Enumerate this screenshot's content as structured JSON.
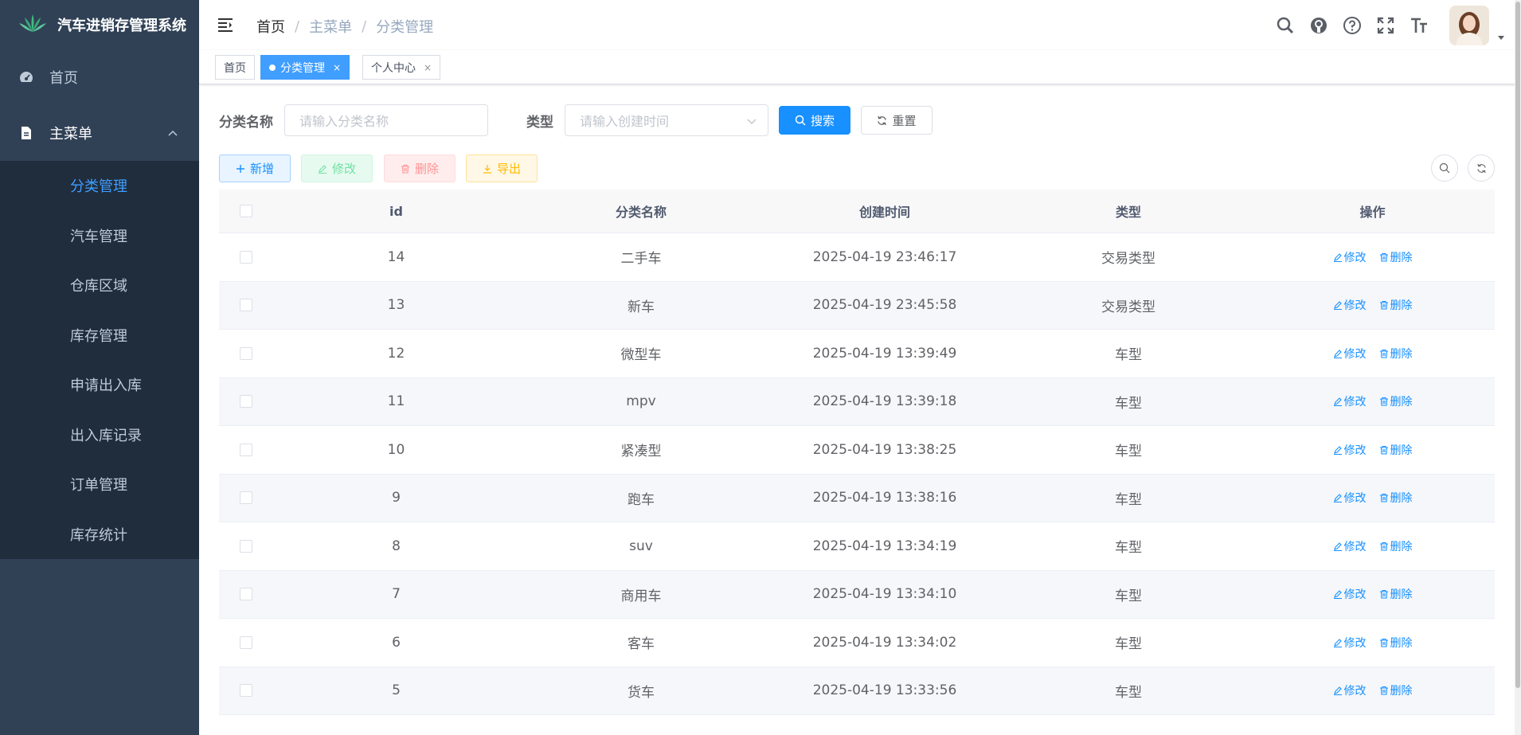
{
  "app": {
    "title": "汽车进销存管理系统"
  },
  "sidebar": {
    "home_label": "首页",
    "main_menu_label": "主菜单",
    "items": [
      {
        "label": "分类管理",
        "active": true
      },
      {
        "label": "汽车管理"
      },
      {
        "label": "仓库区域"
      },
      {
        "label": "库存管理"
      },
      {
        "label": "申请出入库"
      },
      {
        "label": "出入库记录"
      },
      {
        "label": "订单管理"
      },
      {
        "label": "库存统计"
      }
    ]
  },
  "breadcrumb": [
    "首页",
    "主菜单",
    "分类管理"
  ],
  "tags": [
    {
      "label": "首页"
    },
    {
      "label": "分类管理",
      "active": true,
      "close": "×"
    },
    {
      "label": "个人中心",
      "close": "×"
    }
  ],
  "search": {
    "name_label": "分类名称",
    "name_placeholder": "请输入分类名称",
    "type_label": "类型",
    "type_placeholder": "请输入创建时间",
    "search_button": "搜索",
    "reset_button": "重置"
  },
  "toolbar": {
    "add": "新增",
    "edit": "修改",
    "delete": "删除",
    "export": "导出"
  },
  "table": {
    "columns": [
      "id",
      "分类名称",
      "创建时间",
      "类型",
      "操作"
    ],
    "edit_label": "修改",
    "delete_label": "删除",
    "rows": [
      {
        "id": "14",
        "name": "二手车",
        "time": "2025-04-19 23:46:17",
        "type": "交易类型"
      },
      {
        "id": "13",
        "name": "新车",
        "time": "2025-04-19 23:45:58",
        "type": "交易类型"
      },
      {
        "id": "12",
        "name": "微型车",
        "time": "2025-04-19 13:39:49",
        "type": "车型"
      },
      {
        "id": "11",
        "name": "mpv",
        "time": "2025-04-19 13:39:18",
        "type": "车型"
      },
      {
        "id": "10",
        "name": "紧凑型",
        "time": "2025-04-19 13:38:25",
        "type": "车型"
      },
      {
        "id": "9",
        "name": "跑车",
        "time": "2025-04-19 13:38:16",
        "type": "车型"
      },
      {
        "id": "8",
        "name": "suv",
        "time": "2025-04-19 13:34:19",
        "type": "车型"
      },
      {
        "id": "7",
        "name": "商用车",
        "time": "2025-04-19 13:34:10",
        "type": "车型"
      },
      {
        "id": "6",
        "name": "客车",
        "time": "2025-04-19 13:34:02",
        "type": "车型"
      },
      {
        "id": "5",
        "name": "货车",
        "time": "2025-04-19 13:33:56",
        "type": "车型"
      }
    ]
  },
  "colors": {
    "sidebar_bg": "#304156",
    "submenu_bg": "#1f2d3d",
    "accent": "#1890ff",
    "active_menu": "#409eff"
  },
  "icons": {
    "logo": "lotus-logo-icon",
    "nav": [
      "search-icon",
      "github-icon",
      "question-icon",
      "fullscreen-icon",
      "font-size-icon"
    ]
  }
}
